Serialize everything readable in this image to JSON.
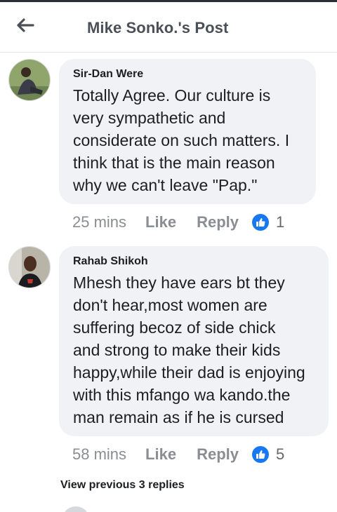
{
  "header": {
    "back_icon": "arrow-left-icon",
    "title": "Mike Sonko.'s Post"
  },
  "comments": [
    {
      "author": "Sir-Dan Were",
      "lines": [
        "Totally Agree. Our culture is",
        "very sympathetic and",
        "considerate on such matters. I",
        "think that is the main reason",
        "why we can't leave \"Pap.\""
      ],
      "time": "25 mins",
      "like_label": "Like",
      "reply_label": "Reply",
      "reaction_count": "1"
    },
    {
      "author": "Rahab Shikoh",
      "lines": [
        "Mhesh they have ears bt they",
        "don't hear,most women are",
        "suffering becoz of side chick",
        "and strong to make their kids",
        "happy,while their dad is enjoying",
        "with this mfango wa kando.the",
        "man remain as if he is cursed"
      ],
      "time": "58 mins",
      "like_label": "Like",
      "reply_label": "Reply",
      "reaction_count": "5"
    }
  ],
  "view_previous": "View previous 3 replies",
  "colors": {
    "like_blue": "#1877f2",
    "bubble_bg": "#f0f2f5",
    "meta_gray": "#8a8d91"
  }
}
